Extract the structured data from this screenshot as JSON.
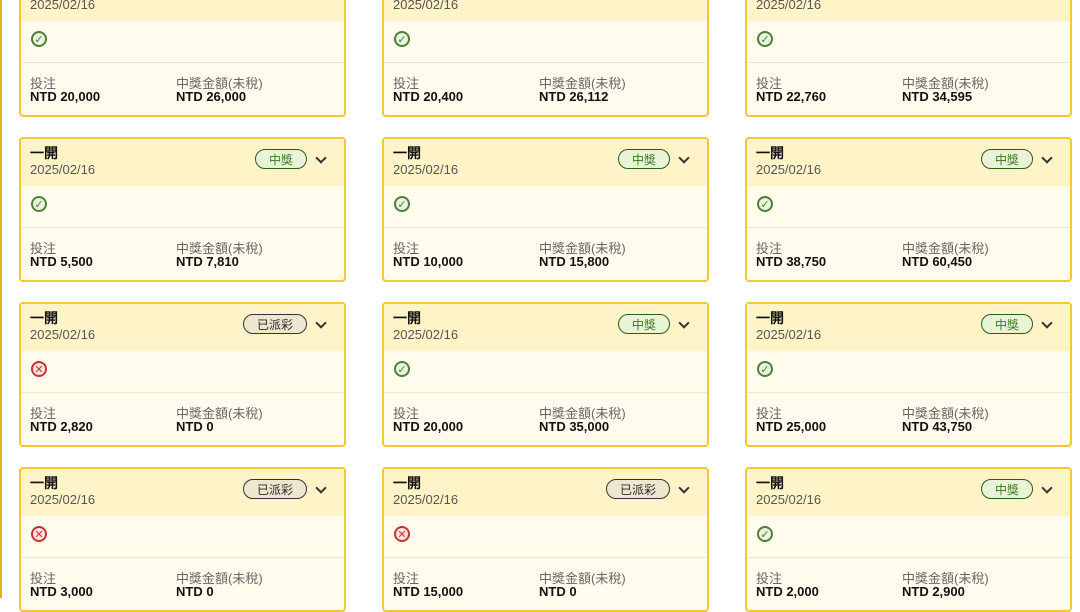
{
  "labels": {
    "bet": "投注",
    "prize_label": "中獎金額(未稅)"
  },
  "cards": [
    {
      "title": "",
      "date": "2025/02/16",
      "badge": "",
      "status": "win",
      "bet": "NTD 20,000",
      "prize": "NTD 26,000"
    },
    {
      "title": "",
      "date": "2025/02/16",
      "badge": "",
      "status": "win",
      "bet": "NTD 20,400",
      "prize": "NTD 26,112"
    },
    {
      "title": "",
      "date": "2025/02/16",
      "badge": "",
      "status": "win",
      "bet": "NTD 22,760",
      "prize": "NTD 34,595"
    },
    {
      "title": "一開",
      "date": "2025/02/16",
      "badge": "中獎",
      "status": "win",
      "bet": "NTD 5,500",
      "prize": "NTD 7,810"
    },
    {
      "title": "一開",
      "date": "2025/02/16",
      "badge": "中獎",
      "status": "win",
      "bet": "NTD 10,000",
      "prize": "NTD 15,800"
    },
    {
      "title": "一開",
      "date": "2025/02/16",
      "badge": "中獎",
      "status": "win",
      "bet": "NTD 38,750",
      "prize": "NTD 60,450"
    },
    {
      "title": "一開",
      "date": "2025/02/16",
      "badge": "已派彩",
      "status": "lose",
      "bet": "NTD 2,820",
      "prize": "NTD 0"
    },
    {
      "title": "一開",
      "date": "2025/02/16",
      "badge": "中獎",
      "status": "win",
      "bet": "NTD 20,000",
      "prize": "NTD 35,000"
    },
    {
      "title": "一開",
      "date": "2025/02/16",
      "badge": "中獎",
      "status": "win",
      "bet": "NTD 25,000",
      "prize": "NTD 43,750"
    },
    {
      "title": "一開",
      "date": "2025/02/16",
      "badge": "已派彩",
      "status": "lose",
      "bet": "NTD 3,000",
      "prize": "NTD 0"
    },
    {
      "title": "一開",
      "date": "2025/02/16",
      "badge": "已派彩",
      "status": "lose",
      "bet": "NTD 15,000",
      "prize": "NTD 0"
    },
    {
      "title": "一開",
      "date": "2025/02/16",
      "badge": "中獎",
      "status": "win",
      "bet": "NTD 2,000",
      "prize": "NTD 2,900"
    }
  ],
  "colors": {
    "card_border": "#f2c833",
    "card_header": "#fff4c8",
    "win_green": "#4f7f34",
    "lose_red": "#c63232"
  },
  "icons": {
    "win": "check-circle-icon",
    "lose": "x-circle-icon",
    "expand": "chevron-down-icon"
  }
}
